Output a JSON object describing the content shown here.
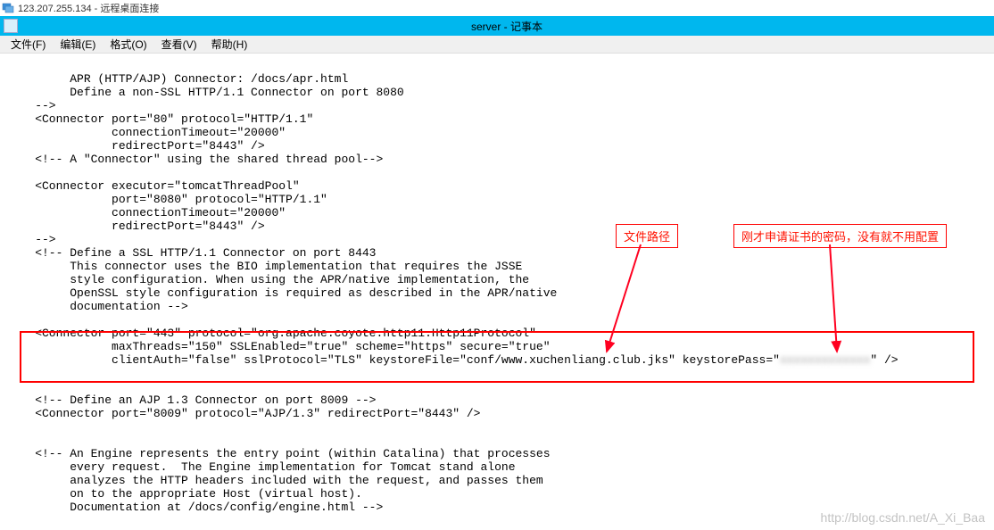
{
  "rdp": {
    "ip": "123.207.255.134",
    "suffix": " - 远程桌面连接"
  },
  "app": {
    "title": "server - 记事本"
  },
  "menu": {
    "file": "文件(F)",
    "edit": "编辑(E)",
    "format": "格式(O)",
    "view": "查看(V)",
    "help": "帮助(H)"
  },
  "annotations": {
    "path": "文件路径",
    "password": "刚才申请证书的密码，没有就不用配置"
  },
  "code": {
    "l1": "         APR (HTTP/AJP) Connector: /docs/apr.html",
    "l2": "         Define a non-SSL HTTP/1.1 Connector on port 8080",
    "l3": "    -->",
    "l4": "    <Connector port=\"80\" protocol=\"HTTP/1.1\"",
    "l5": "               connectionTimeout=\"20000\"",
    "l6": "               redirectPort=\"8443\" />",
    "l7": "    <!-- A \"Connector\" using the shared thread pool-->",
    "l8": "    ",
    "l9": "    <Connector executor=\"tomcatThreadPool\"",
    "l10": "               port=\"8080\" protocol=\"HTTP/1.1\"",
    "l11": "               connectionTimeout=\"20000\"",
    "l12": "               redirectPort=\"8443\" />",
    "l13": "    -->",
    "l14": "    <!-- Define a SSL HTTP/1.1 Connector on port 8443",
    "l15": "         This connector uses the BIO implementation that requires the JSSE",
    "l16": "         style configuration. When using the APR/native implementation, the",
    "l17": "         OpenSSL style configuration is required as described in the APR/native",
    "l18": "         documentation -->",
    "l19": "   ",
    "l20": "    <Connector port=\"443\" protocol=\"org.apache.coyote.http11.Http11Protocol\"",
    "l21": "               maxThreads=\"150\" SSLEnabled=\"true\" scheme=\"https\" secure=\"true\"",
    "l22a": "               clientAuth=\"false\" sslProtocol=\"TLS\" keystoreFile=\"conf/www.xuchenliang.club.jks\" keystorePass=\"",
    "l22b": "xxxxxxxxxxxxx",
    "l22c": "\" />",
    "l23": "   ",
    "l24": "",
    "l25": "    <!-- Define an AJP 1.3 Connector on port 8009 -->",
    "l26": "    <Connector port=\"8009\" protocol=\"AJP/1.3\" redirectPort=\"8443\" />",
    "l27": "",
    "l28": "",
    "l29": "    <!-- An Engine represents the entry point (within Catalina) that processes",
    "l30": "         every request.  The Engine implementation for Tomcat stand alone",
    "l31": "         analyzes the HTTP headers included with the request, and passes them",
    "l32": "         on to the appropriate Host (virtual host).",
    "l33": "         Documentation at /docs/config/engine.html -->"
  },
  "watermark": "http://blog.csdn.net/A_Xi_Baa"
}
